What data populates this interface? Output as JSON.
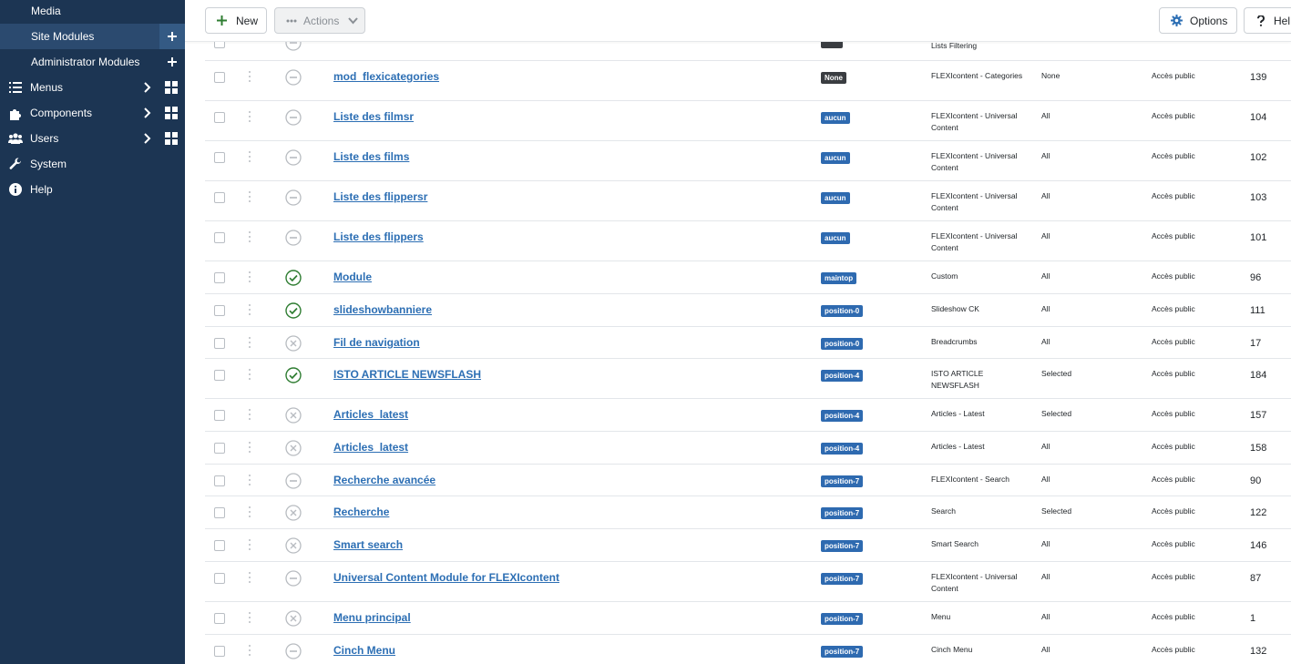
{
  "sidebar": {
    "media": "Media",
    "site_modules": "Site Modules",
    "admin_modules": "Administrator Modules",
    "menus": "Menus",
    "components": "Components",
    "users": "Users",
    "system": "System",
    "help": "Help"
  },
  "toolbar": {
    "new_label": "New",
    "actions_label": "Actions",
    "options_label": "Options",
    "help_label": "Hel"
  },
  "colors": {
    "sidebar_bg": "#1c3553",
    "link": "#2d6fb4",
    "badge": "#2e6ab0",
    "published": "#2f7d32"
  },
  "top_partial": {
    "type": "Lists Filtering"
  },
  "modules": [
    {
      "title": "mod_flexicategories",
      "position": "None",
      "badge_style": "dark",
      "type": "FLEXIcontent - Categories",
      "pages": "None",
      "access": "Accès public",
      "id": "139",
      "status": "disabled"
    },
    {
      "title": "Liste des filmsr",
      "position": "aucun",
      "type": "FLEXIcontent - Universal Content",
      "pages": "All",
      "access": "Accès public",
      "id": "104",
      "status": "disabled"
    },
    {
      "title": "Liste des films",
      "position": "aucun",
      "type": "FLEXIcontent - Universal Content",
      "pages": "All",
      "access": "Accès public",
      "id": "102",
      "status": "disabled"
    },
    {
      "title": "Liste des flippersr",
      "position": "aucun",
      "type": "FLEXIcontent - Universal Content",
      "pages": "All",
      "access": "Accès public",
      "id": "103",
      "status": "disabled"
    },
    {
      "title": "Liste des flippers",
      "position": "aucun",
      "type": "FLEXIcontent - Universal Content",
      "pages": "All",
      "access": "Accès public",
      "id": "101",
      "status": "disabled"
    },
    {
      "title": "Module",
      "position": "maintop",
      "type": "Custom",
      "pages": "All",
      "access": "Accès public",
      "id": "96",
      "status": "published"
    },
    {
      "title": "slideshowbanniere",
      "position": "position-0",
      "type": "Slideshow CK",
      "pages": "All",
      "access": "Accès public",
      "id": "111",
      "status": "published"
    },
    {
      "title": "Fil de navigation",
      "position": "position-0",
      "type": "Breadcrumbs",
      "pages": "All",
      "access": "Accès public",
      "id": "17",
      "status": "unpublished"
    },
    {
      "title": "ISTO ARTICLE NEWSFLASH",
      "position": "position-4",
      "type": "ISTO ARTICLE NEWSFLASH",
      "pages": "Selected",
      "access": "Accès public",
      "id": "184",
      "status": "published"
    },
    {
      "title": "Articles_latest",
      "position": "position-4",
      "type": "Articles - Latest",
      "pages": "Selected",
      "access": "Accès public",
      "id": "157",
      "status": "unpublished"
    },
    {
      "title": "Articles_latest",
      "position": "position-4",
      "type": "Articles - Latest",
      "pages": "All",
      "access": "Accès public",
      "id": "158",
      "status": "unpublished"
    },
    {
      "title": "Recherche avancée",
      "position": "position-7",
      "type": "FLEXIcontent - Search",
      "pages": "All",
      "access": "Accès public",
      "id": "90",
      "status": "disabled"
    },
    {
      "title": "Recherche",
      "position": "position-7",
      "type": "Search",
      "pages": "Selected",
      "access": "Accès public",
      "id": "122",
      "status": "unpublished"
    },
    {
      "title": "Smart search",
      "position": "position-7",
      "type": "Smart Search",
      "pages": "All",
      "access": "Accès public",
      "id": "146",
      "status": "unpublished"
    },
    {
      "title": "Universal Content Module for FLEXIcontent",
      "position": "position-7",
      "type": "FLEXIcontent - Universal Content",
      "pages": "All",
      "access": "Accès public",
      "id": "87",
      "status": "disabled"
    },
    {
      "title": "Menu principal",
      "position": "position-7",
      "type": "Menu",
      "pages": "All",
      "access": "Accès public",
      "id": "1",
      "status": "unpublished"
    },
    {
      "title": "Cinch Menu",
      "position": "position-7",
      "type": "Cinch Menu",
      "pages": "All",
      "access": "Accès public",
      "id": "132",
      "status": "disabled"
    }
  ]
}
